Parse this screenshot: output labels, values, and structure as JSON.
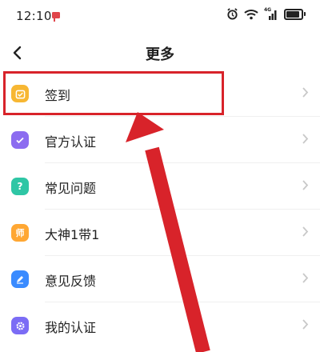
{
  "status_bar": {
    "time": "12:10",
    "icons": [
      "notification-icon",
      "alarm-icon",
      "wifi-icon",
      "signal-icon",
      "battery-icon"
    ],
    "signal_label": "4G"
  },
  "nav": {
    "title": "更多"
  },
  "menu": {
    "items": [
      {
        "label": "签到",
        "icon": "checkin-icon",
        "color": "#f7b733"
      },
      {
        "label": "官方认证",
        "icon": "check-badge-icon",
        "color": "#8c6cf0"
      },
      {
        "label": "常见问题",
        "icon": "question-icon",
        "color": "#2fc6a5"
      },
      {
        "label": "大神1带1",
        "icon": "mentor-icon",
        "icon_char": "师",
        "color": "#ffa733"
      },
      {
        "label": "意见反馈",
        "icon": "pen-icon",
        "color": "#3a8bff"
      },
      {
        "label": "我的认证",
        "icon": "gear-icon",
        "color": "#7b6cf5"
      }
    ]
  },
  "annotation": {
    "color": "#d8232a"
  }
}
